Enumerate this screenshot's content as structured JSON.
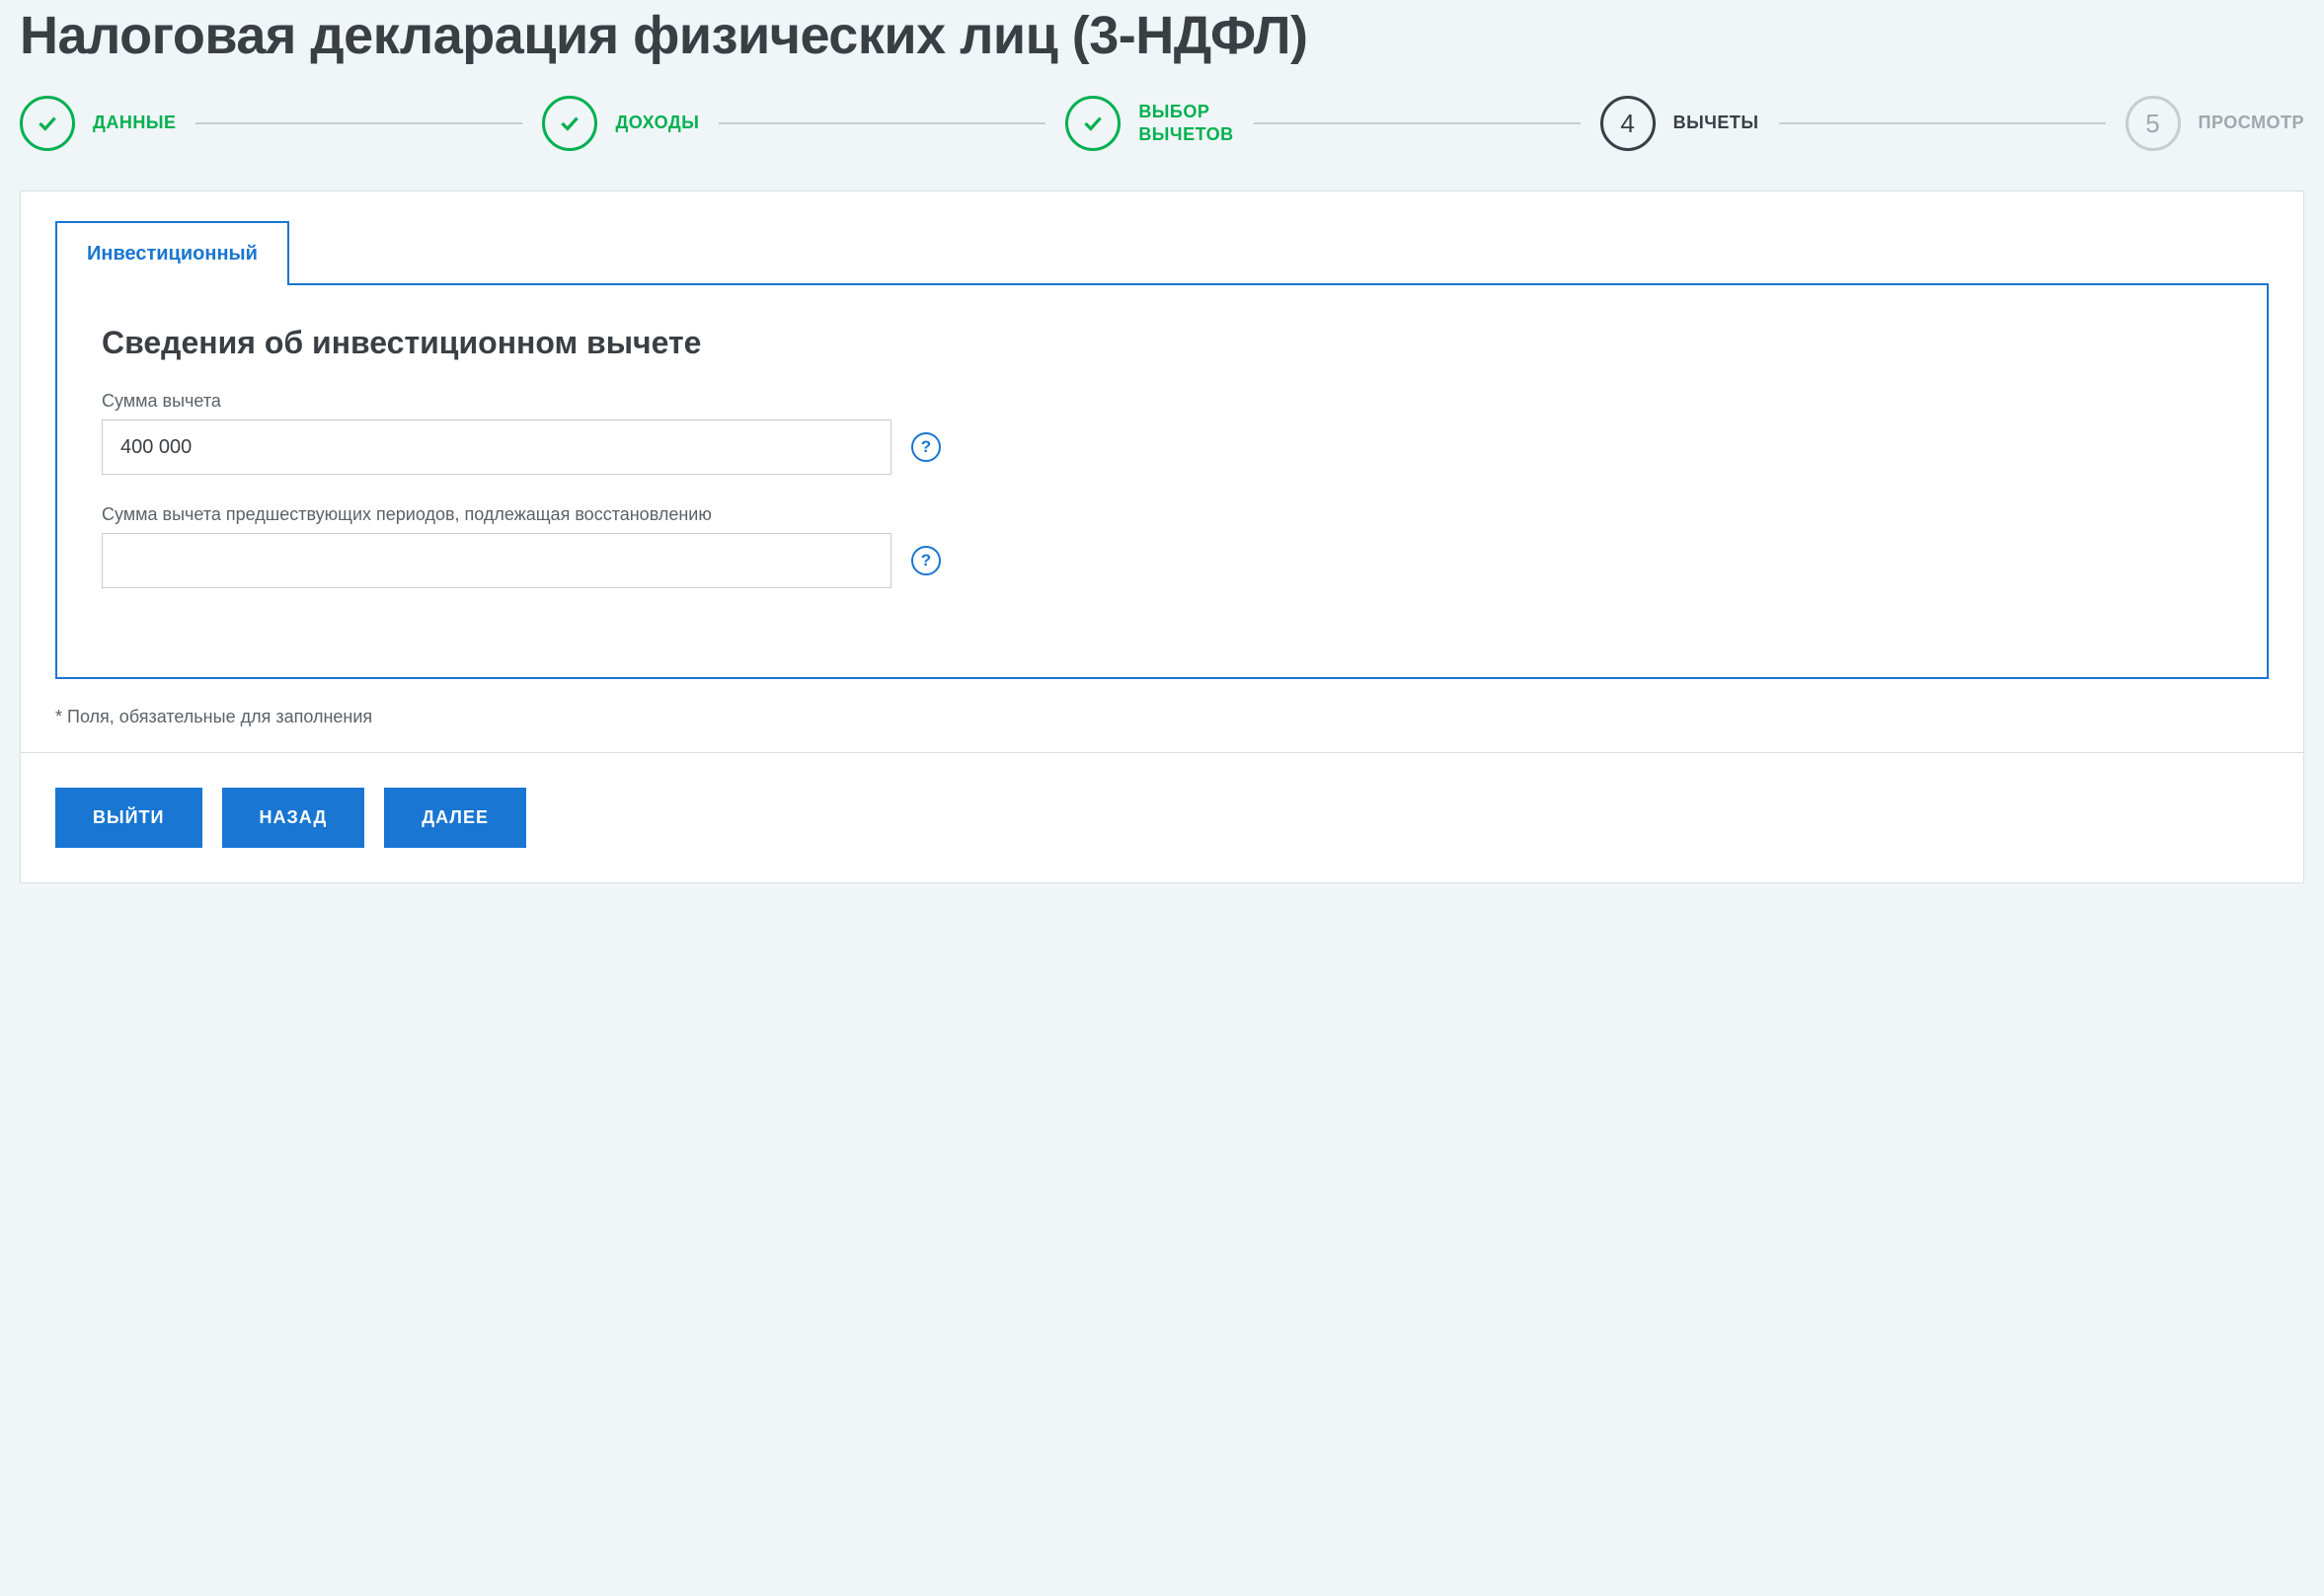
{
  "page": {
    "title": "Налоговая декларация физических лиц (3-НДФЛ)"
  },
  "stepper": {
    "steps": [
      {
        "label": "ДАННЫЕ",
        "state": "done"
      },
      {
        "label": "ДОХОДЫ",
        "state": "done"
      },
      {
        "label": "ВЫБОР\nВЫЧЕТОВ",
        "state": "done"
      },
      {
        "number": "4",
        "label": "ВЫЧЕТЫ",
        "state": "active"
      },
      {
        "number": "5",
        "label": "ПРОСМОТР",
        "state": "pending"
      }
    ]
  },
  "tab": {
    "label": "Инвестиционный"
  },
  "form": {
    "section_title": "Сведения об инвестиционном вычете",
    "fields": {
      "amount": {
        "label": "Сумма вычета",
        "value": "400 000"
      },
      "restore": {
        "label": "Сумма вычета предшествующих периодов, подлежащая восстановлению",
        "value": ""
      }
    },
    "footnote": "* Поля, обязательные для заполнения"
  },
  "buttons": {
    "exit": "ВЫЙТИ",
    "back": "НАЗАД",
    "next": "ДАЛЕЕ"
  },
  "icons": {
    "help": "?"
  }
}
